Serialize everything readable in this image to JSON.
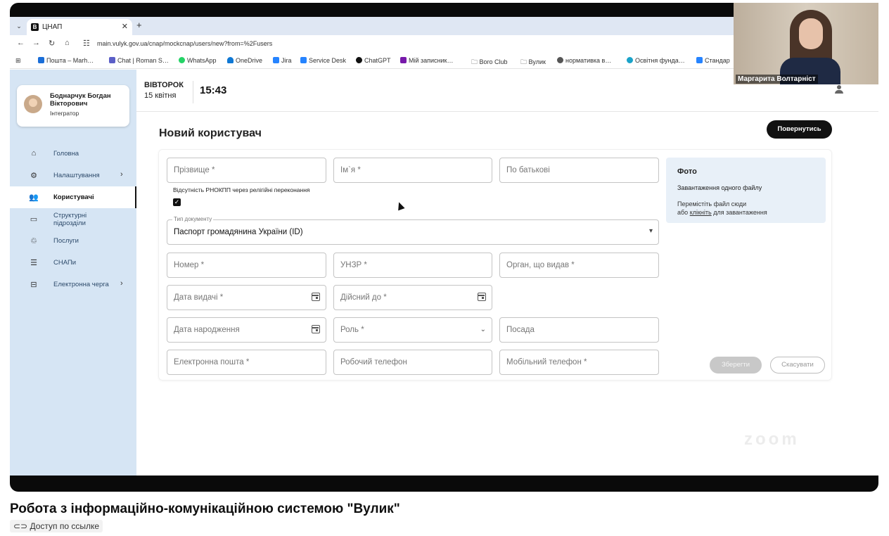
{
  "browser": {
    "tab_title": "ЦНАП",
    "tab_favicon": "В",
    "url_host": "main.vulyk.gov.ua",
    "url_path": "/cnap/mockcnap/users/new?from=%2Fusers",
    "bookmarks": [
      "Пошта – Marh…",
      "Chat | Roman S…",
      "WhatsApp",
      "OneDrive",
      "Jira",
      "Service Desk",
      "ChatGPT",
      "Мій записник…",
      "Boro Club",
      "Вулик",
      "нормативка в…",
      "Освітня фунда…",
      "Стандар"
    ]
  },
  "profile": {
    "name": "Боднарчук Богдан Вікторович",
    "role": "Інтегратор"
  },
  "nav": [
    {
      "label": "Головна",
      "icon": "home-icon",
      "chevron": false,
      "active": false
    },
    {
      "label": "Налаштування",
      "icon": "gear-icon",
      "chevron": true,
      "active": false
    },
    {
      "label": "Користувачі",
      "icon": "users-icon",
      "chevron": false,
      "active": true
    },
    {
      "label": "Структурні підрозділи",
      "icon": "briefcase-icon",
      "chevron": false,
      "active": false
    },
    {
      "label": "Послуги",
      "icon": "services-icon",
      "chevron": false,
      "active": false
    },
    {
      "label": "СНАПи",
      "icon": "list-icon",
      "chevron": false,
      "active": false
    },
    {
      "label": "Електронна черга",
      "icon": "queue-icon",
      "chevron": true,
      "active": false
    }
  ],
  "header": {
    "day": "ВІВТОРОК",
    "date": "15 квітня",
    "time": "15:43"
  },
  "page": {
    "title": "Новий користувач",
    "back_button": "Повернутись"
  },
  "form": {
    "last_name": "Прізвище *",
    "first_name": "Ім`я *",
    "middle_name": "По батькові",
    "no_rnokpp_label": "Відсутність РНОКПП через релігійні переконання",
    "no_rnokpp_checked": true,
    "doc_type_label": "Тип документу",
    "doc_type_value": "Паспорт громадянина України (ID)",
    "number": "Номер *",
    "unzr": "УНЗР *",
    "issuer": "Орган, що видав *",
    "issue_date": "Дата видачі *",
    "valid_until": "Дійсний до *",
    "birth_date": "Дата народження",
    "role": "Роль *",
    "position": "Посада",
    "email": "Електронна пошта *",
    "work_phone": "Робочий телефон",
    "mobile_phone": "Мобільний телефон *",
    "save_button": "Зберегти",
    "cancel_button": "Скасувати"
  },
  "photo": {
    "title": "Фото",
    "subtitle": "Завантаження одного файлу",
    "hint_line1": "Перемістіть файл сюди",
    "hint_prefix": "або",
    "hint_link": "клікніть",
    "hint_suffix": "для завантаження"
  },
  "webcam": {
    "name": "Маргарита Волтарніст"
  },
  "video": {
    "title": "Робота з інформаційно-комунікаційною системою \"Вулик\"",
    "access": "Доступ по ссылке"
  }
}
